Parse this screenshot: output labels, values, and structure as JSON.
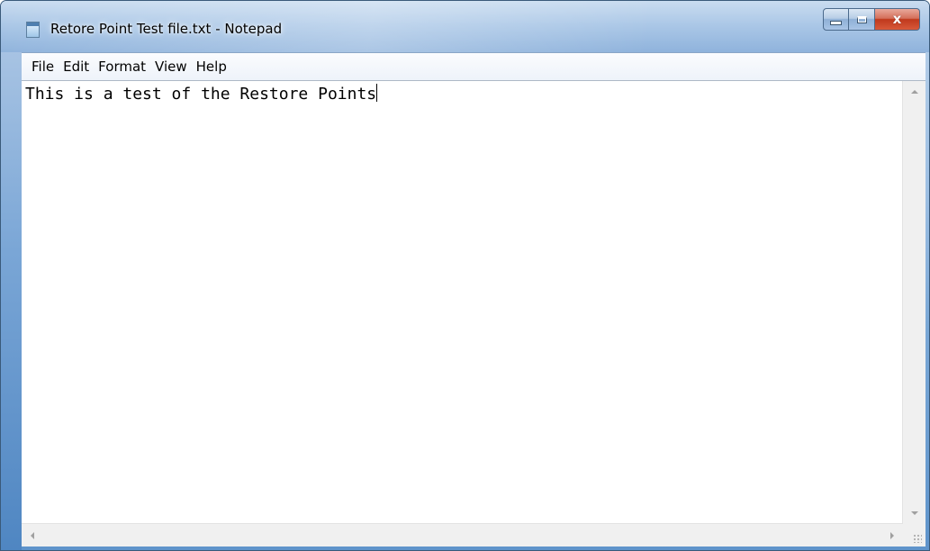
{
  "window": {
    "title": "Retore Point Test file.txt - Notepad"
  },
  "caption_buttons": {
    "minimize_icon": "minimize-icon",
    "maximize_icon": "maximize-icon",
    "close_glyph": "x"
  },
  "menu": {
    "items": [
      "File",
      "Edit",
      "Format",
      "View",
      "Help"
    ]
  },
  "editor": {
    "text": "This is a test of the Restore Points"
  },
  "colors": {
    "frame": "#79a7d6",
    "close_button": "#c0391d"
  }
}
